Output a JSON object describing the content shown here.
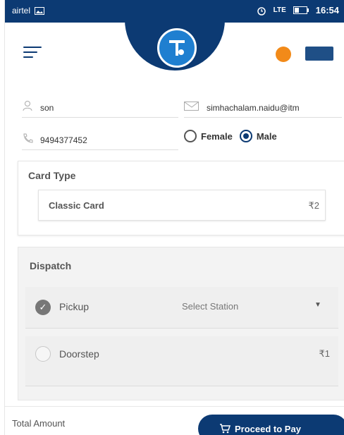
{
  "status_bar": {
    "carrier": "airtel",
    "time": "16:54",
    "signal_text": "LTE",
    "icons": [
      "image-icon",
      "alarm-icon",
      "signal-icon",
      "battery-icon"
    ]
  },
  "header": {
    "icons": [
      "menu-icon",
      "app-logo",
      "notification-icon",
      "profile-icon"
    ]
  },
  "form": {
    "name_value": "son",
    "email_value": "simhachalam.naidu@itm",
    "phone_value": "9494377452",
    "gender_options": [
      "Female",
      "Male"
    ],
    "gender_selected": "Male"
  },
  "card_type": {
    "title": "Card Type",
    "card_name": "Classic Card",
    "price": "₹2"
  },
  "dispatch": {
    "title": "Dispatch",
    "pickup_label": "Pickup",
    "station_placeholder": "Select Station",
    "doorstep_label": "Doorstep",
    "doorstep_price": "₹1",
    "selected": "Pickup"
  },
  "footer": {
    "total_label": "Total Amount",
    "pay_button": "Proceed to Pay"
  },
  "colors": {
    "primary": "#0c3a73",
    "accent_orange": "#f28a19"
  }
}
